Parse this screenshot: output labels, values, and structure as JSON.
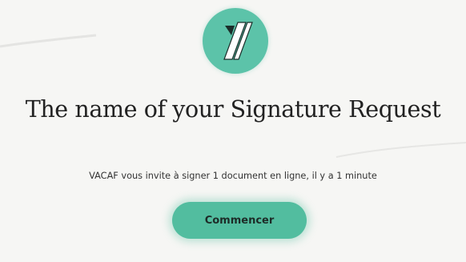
{
  "brand": {
    "logo_icon": "yousign-logo-icon",
    "accent_color": "#5cc3a9"
  },
  "signature_request": {
    "title": "The name of your Signature Request",
    "invitation_text": "VACAF vous invite à signer 1 document en ligne, il y a 1 minute"
  },
  "actions": {
    "start_label": "Commencer"
  }
}
